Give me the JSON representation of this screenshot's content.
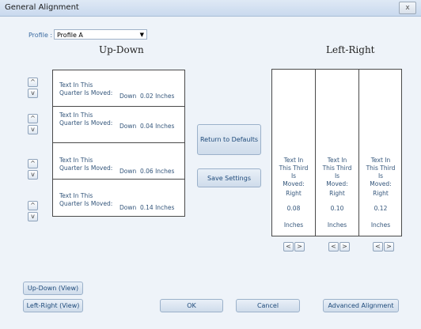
{
  "window": {
    "title": "General Alignment",
    "close_glyph": "x"
  },
  "profile": {
    "label": "Profile :",
    "selected": "Profile A",
    "dropdown_glyph": "▼"
  },
  "updown": {
    "heading": "Up-Down",
    "rows": [
      {
        "text_line1": "Text In This",
        "text_line2": "Quarter Is Moved:",
        "direction": "Down",
        "value": "0.02 Inches"
      },
      {
        "text_line1": "Text In This",
        "text_line2": "Quarter Is Moved:",
        "direction": "Down",
        "value": "0.04 Inches"
      },
      {
        "text_line1": "Text In This",
        "text_line2": "Quarter Is Moved:",
        "direction": "Down",
        "value": "0.06 Inches"
      },
      {
        "text_line1": "Text In This",
        "text_line2": "Quarter Is Moved:",
        "direction": "Down",
        "value": "0.14 Inches"
      }
    ],
    "up_glyph": "^",
    "down_glyph": "v"
  },
  "middle": {
    "return_defaults": "Return to Defaults",
    "save_settings": "Save Settings"
  },
  "leftright": {
    "heading": "Left-Right",
    "columns": [
      {
        "text_line1": "Text In",
        "text_line2": "This Third",
        "text_line3": "Is",
        "text_line4": "Moved:",
        "direction": "Right",
        "value": "0.08",
        "unit": "Inches"
      },
      {
        "text_line1": "Text In",
        "text_line2": "This Third",
        "text_line3": "Is",
        "text_line4": "Moved:",
        "direction": "Right",
        "value": "0.10",
        "unit": "Inches"
      },
      {
        "text_line1": "Text In",
        "text_line2": "This Third",
        "text_line3": "Is",
        "text_line4": "Moved:",
        "direction": "Right",
        "value": "0.12",
        "unit": "Inches"
      }
    ],
    "left_glyph": "<",
    "right_glyph": ">"
  },
  "bottom": {
    "updown_view": "Up-Down (View)",
    "leftright_view": "Left-Right (View)",
    "ok": "OK",
    "cancel": "Cancel",
    "advanced": "Advanced Alignment"
  }
}
